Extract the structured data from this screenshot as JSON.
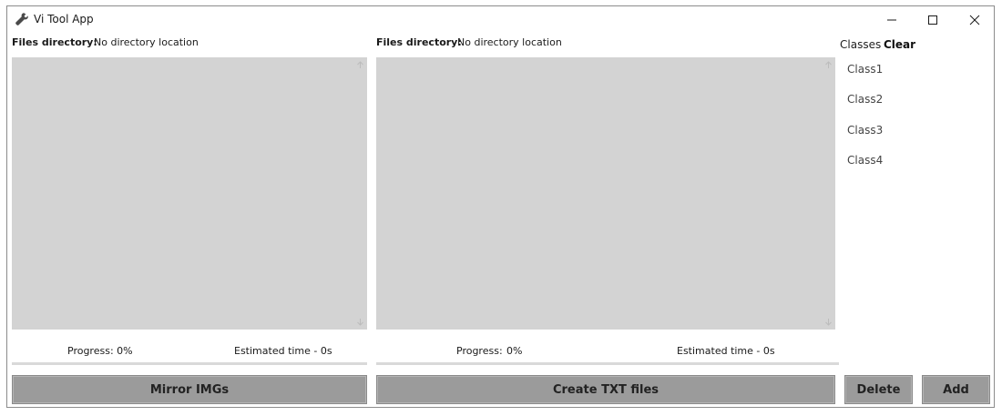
{
  "window": {
    "title": "Vi Tool App",
    "icon": "wrench-icon",
    "controls": [
      "minimize-icon",
      "maximize-icon",
      "close-icon"
    ]
  },
  "left_panel": {
    "dir_label": "Files directory:",
    "dir_value": "No directory location",
    "progress_label": "Progress: 0%",
    "progress_value": 0,
    "estimate_label": "Estimated time - 0s",
    "action_label": "Mirror IMGs"
  },
  "middle_panel": {
    "dir_label": "Files directory:",
    "dir_value": "No directory location",
    "progress_label": "Progress:",
    "progress_percent": "0%",
    "progress_value": 0,
    "estimate_label": "Estimated time - 0s",
    "action_label": "Create TXT files"
  },
  "classes_panel": {
    "heading": "Classes",
    "clear_label": "Clear",
    "items": [
      "Class1",
      "Class2",
      "Class3",
      "Class4"
    ],
    "delete_label": "Delete",
    "add_label": "Add"
  },
  "colors": {
    "listbox_bg": "#d3d3d3",
    "button_bg": "#9b9b9b",
    "window_border": "#8c8c8c"
  }
}
